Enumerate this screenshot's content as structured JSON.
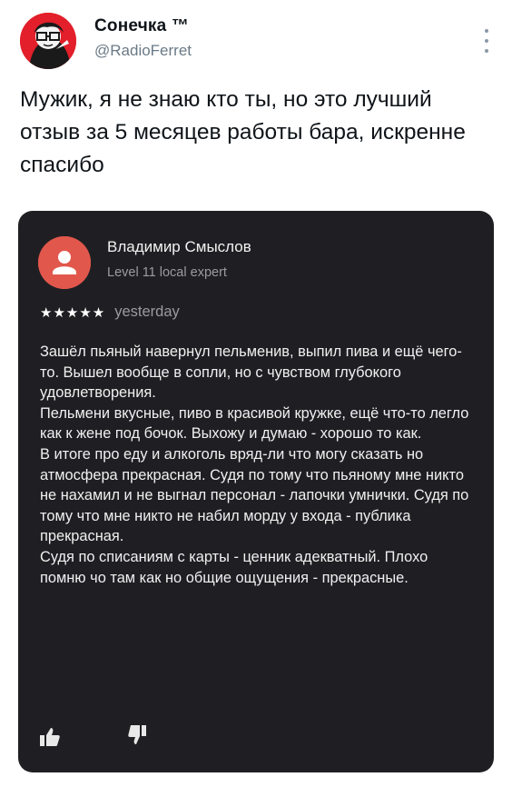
{
  "tweet": {
    "author_name": "Сонечка ™",
    "handle": "@RadioFerret",
    "text": "Мужик, я не знаю кто ты, но это лучший отзыв за 5 месяцев работы бара, искренне спасибо",
    "icons": {
      "avatar": "profile-avatar-image",
      "more": "more-options-icon"
    }
  },
  "review": {
    "reviewer_name": "Владимир Смыслов",
    "reviewer_level": "Level 11 local expert",
    "stars": "★★★★★",
    "rating": 5,
    "date": "yesterday",
    "paragraphs": [
      "Зашёл пьяный навернул пельменив, выпил пива и ещё чего-то. Вышел вообще в сопли, но с чувством глубокого удовлетворения.",
      "Пельмени вкусные, пиво в красивой кружке, ещё что-то легло как к жене под бочок. Выхожу и думаю - хорошо то как.",
      "В итоге про еду и алкоголь вряд-ли что могу сказать но атмосфера прекрасная. Судя по тому что пьяному мне никто не нахамил и не выгнал персонал - лапочки умнички. Судя по тому что мне никто не набил морду у входа - публика прекрасная.",
      "Судя по списаниям с карты - ценник адекватный. Плохо помню чо там как но общие ощущения - прекрасные."
    ],
    "icons": {
      "avatar": "user-silhouette-icon",
      "like": "thumbs-up-icon",
      "dislike": "thumbs-down-icon"
    },
    "colors": {
      "card_bg": "#1f1f23",
      "avatar_bg": "#e2574c"
    }
  }
}
